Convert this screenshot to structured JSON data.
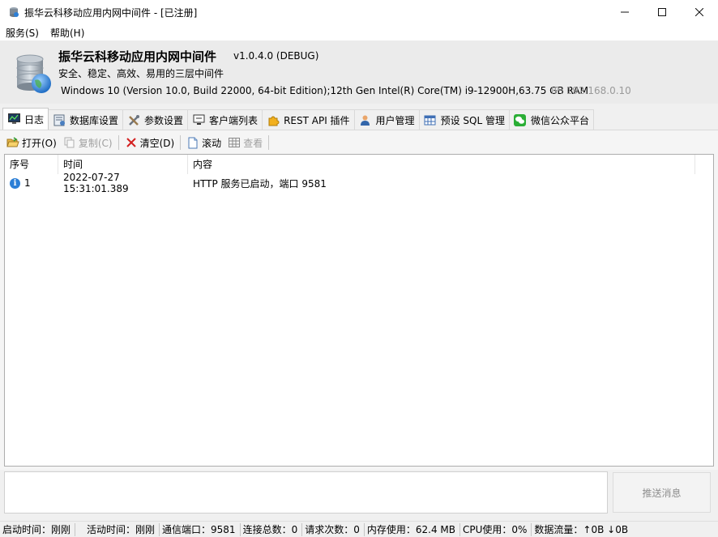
{
  "window": {
    "title": "振华云科移动应用内网中间件 - [已注册]",
    "minimize_glyph": "—",
    "maximize_glyph": "☐",
    "close_glyph": "✕"
  },
  "menu": [
    "服务(S)",
    "帮助(H)"
  ],
  "header": {
    "app_name": "振华云科移动应用内网中间件",
    "version": "v1.0.4.0 (DEBUG)",
    "tagline": "安全、稳定、高效、易用的三层中间件",
    "system_info": "Windows 10 (Version 10.0, Build 22000, 64-bit Edition);12th Gen Intel(R) Core(TM) i9-12900H,63.75 GB RAM",
    "ip": "IP: 192.168.0.10",
    "logo_icon": "database-globe-icon"
  },
  "tabs": [
    {
      "label": "日志",
      "icon": "log-monitor-icon"
    },
    {
      "label": "数据库设置",
      "icon": "database-settings-icon"
    },
    {
      "label": "参数设置",
      "icon": "tools-icon"
    },
    {
      "label": "客户端列表",
      "icon": "client-monitor-icon"
    },
    {
      "label": "REST API 插件",
      "icon": "puzzle-icon"
    },
    {
      "label": "用户管理",
      "icon": "user-icon"
    },
    {
      "label": "预设 SQL 管理",
      "icon": "table-icon"
    },
    {
      "label": "微信公众平台",
      "icon": "wechat-icon"
    }
  ],
  "toolbar": {
    "open": "打开(O)",
    "copy": "复制(C)",
    "clear": "清空(D)",
    "scroll": "滚动",
    "view": "查看"
  },
  "log_table": {
    "columns": [
      "序号",
      "时间",
      "内容"
    ],
    "rows": [
      {
        "index": "1",
        "time": "2022-07-27 15:31:01.389",
        "content": "HTTP 服务已启动，端口 9581",
        "level_icon": "info-icon"
      }
    ]
  },
  "send_button": "推送消息",
  "status": {
    "start_time": "启动时间：刚刚",
    "active_time": "活动时间：刚刚",
    "port": "通信端口：9581",
    "connections": "连接总数：0",
    "requests": "请求次数：0",
    "memory": "内存使用：62.4 MB",
    "cpu": "CPU使用：0%",
    "traffic": "数据流量：↑0B  ↓0B"
  },
  "colors": {
    "accent": "#2c7fd6",
    "clear_red": "#d42020",
    "wechat_green": "#2aae35"
  }
}
